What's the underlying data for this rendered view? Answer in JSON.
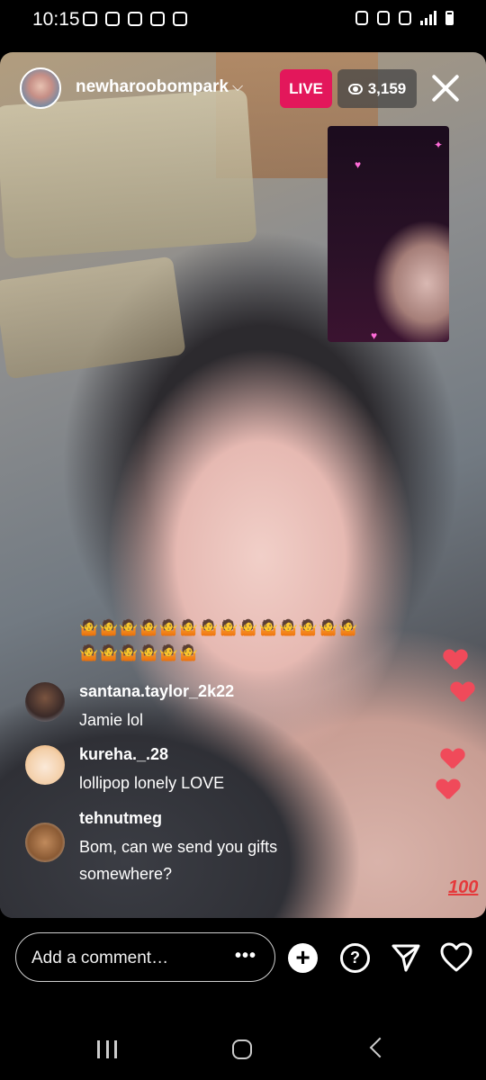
{
  "status_bar": {
    "time": "10:15"
  },
  "header": {
    "host_username": "newharoobompark",
    "live_label": "LIVE",
    "viewer_count": "3,159"
  },
  "emoji_rows": {
    "row1": "🤷🤷🤷🤷🤷🤷🤷🤷🤷🤷🤷🤷🤷🤷",
    "row2": "🤷🤷🤷🤷🤷🤷"
  },
  "comments": [
    {
      "username": "santana.taylor_2k22",
      "text": "Jamie lol"
    },
    {
      "username": "kureha._.28",
      "text": "lollipop lonely LOVE"
    },
    {
      "username": "tehnutmeg",
      "text": "Bom, can we send you gifts somewhere?"
    }
  ],
  "reactions": {
    "hundred_emoji": "100"
  },
  "composer": {
    "placeholder": "Add a comment…",
    "more_label": "•••"
  },
  "colors": {
    "live_badge": "#e3175b",
    "heart": "#f04a5a"
  }
}
